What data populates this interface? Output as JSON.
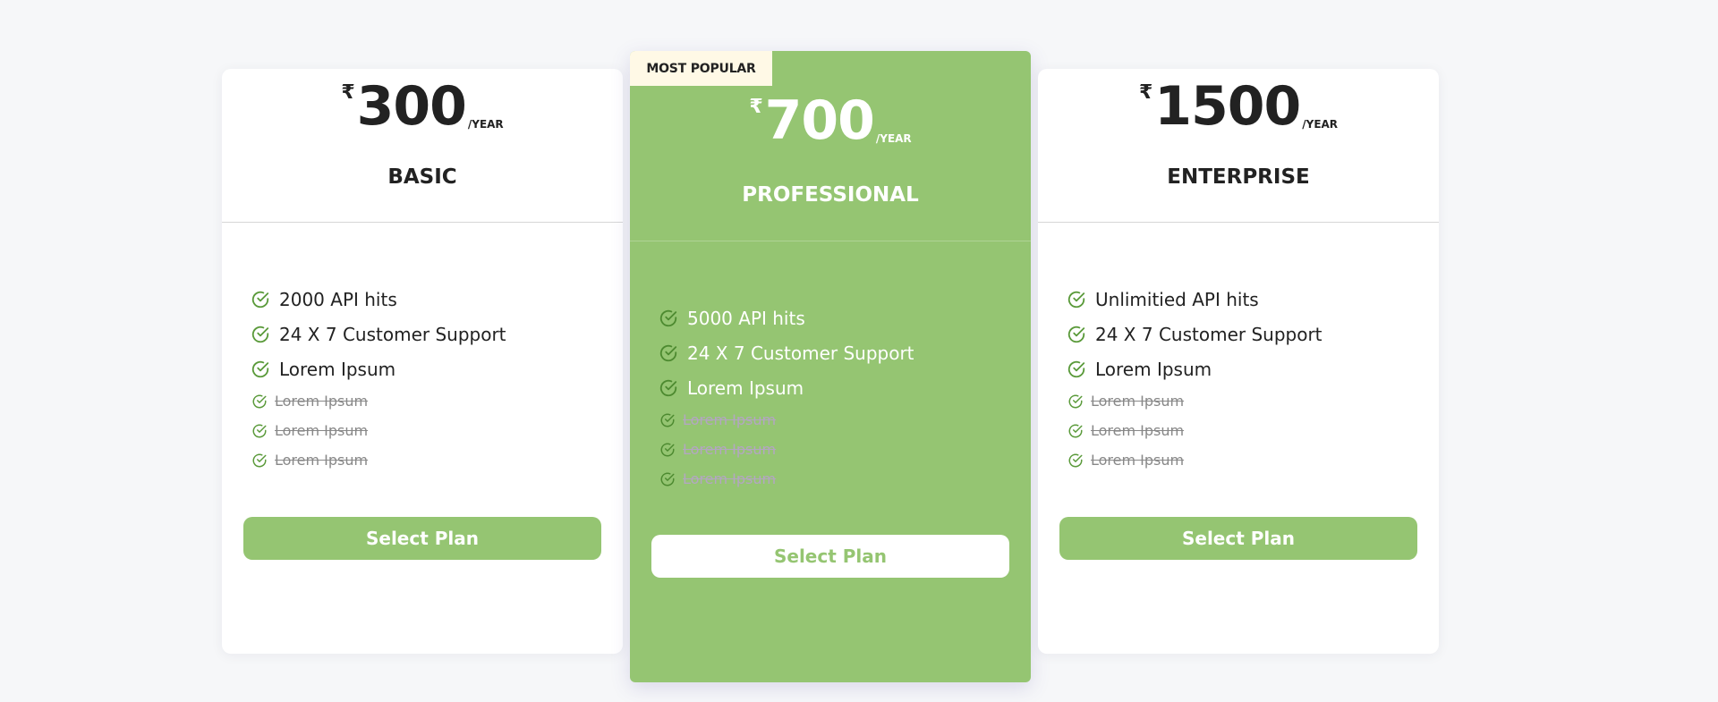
{
  "plans": [
    {
      "currency": "₹",
      "amount": "300",
      "period": "/YEAR",
      "name": "BASIC",
      "features": [
        "2000 API hits",
        "24 X 7 Customer Support",
        "Lorem Ipsum"
      ],
      "disabled_features": [
        "Lorem Ipsum",
        "Lorem Ipsum",
        "Lorem Ipsum"
      ],
      "button_label": "Select Plan"
    },
    {
      "badge": "MOST POPULAR",
      "currency": "₹",
      "amount": "700",
      "period": "/YEAR",
      "name": "PROFESSIONAL",
      "features": [
        "5000 API hits",
        "24 X 7 Customer Support",
        "Lorem Ipsum"
      ],
      "disabled_features": [
        "Lorem Ipsum",
        "Lorem Ipsum",
        "Lorem Ipsum"
      ],
      "button_label": "Select Plan"
    },
    {
      "currency": "₹",
      "amount": "1500",
      "period": "/YEAR",
      "name": "ENTERPRISE",
      "features": [
        "Unlimitied API hits",
        "24 X 7 Customer Support",
        "Lorem Ipsum"
      ],
      "disabled_features": [
        "Lorem Ipsum",
        "Lorem Ipsum",
        "Lorem Ipsum"
      ],
      "button_label": "Select Plan"
    }
  ],
  "icons": {
    "feature": "check-circle-icon"
  },
  "colors": {
    "accent": "#95c572",
    "badge_bg": "#fff9e6",
    "background": "#f6f7f9",
    "text": "#222222",
    "disabled_text": "#888888"
  }
}
